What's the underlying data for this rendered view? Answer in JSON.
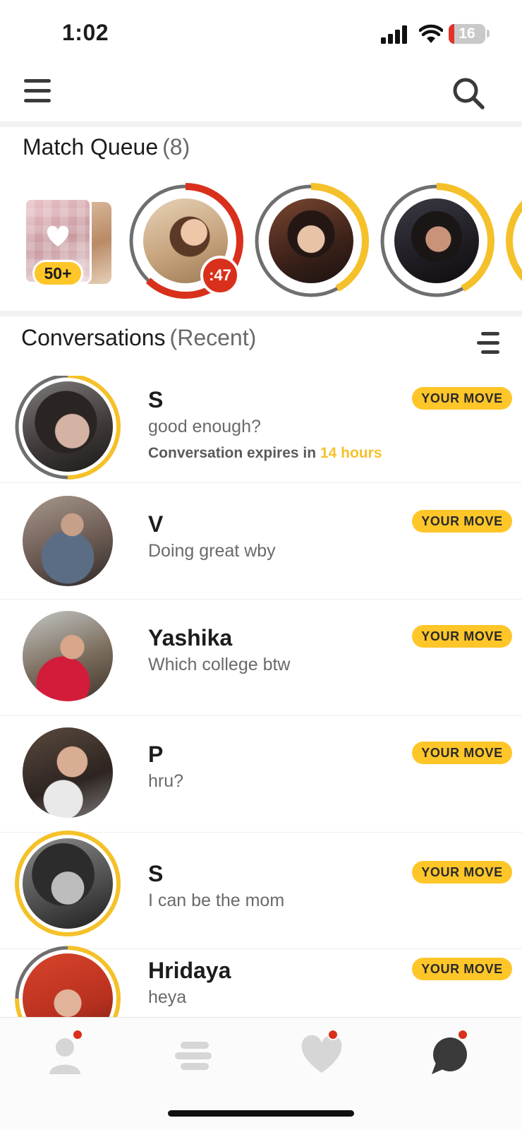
{
  "status_bar": {
    "time": "1:02",
    "battery": "16",
    "battery_fraction": 0.16
  },
  "top_nav": {
    "menu_icon": "hamburger-menu-icon",
    "search_icon": "search-icon"
  },
  "match_queue": {
    "title": "Match Queue",
    "count": "(8)",
    "stack_badge": "50+",
    "items": [
      {
        "badge": ":47",
        "ring_color": "#d9301b",
        "ring_fraction": 0.62
      },
      {
        "ring_color": "#f5c12a",
        "ring_fraction": 0.42
      },
      {
        "ring_color": "#f5c12a",
        "ring_fraction": 0.42
      }
    ]
  },
  "conversations": {
    "title": "Conversations",
    "subtitle": "(Recent)",
    "badge_label": "YOUR MOVE",
    "expiry_prefix": "Conversation expires in",
    "expiry_value": "14 hours",
    "items": [
      {
        "name": "S",
        "message": "good enough?",
        "ring_fraction": 0.5
      },
      {
        "name": "V",
        "message": "Doing great wby"
      },
      {
        "name": "Yashika",
        "message": "Which college btw"
      },
      {
        "name": "P",
        "message": "hru?"
      },
      {
        "name": "S",
        "message": "I can be the mom",
        "ring_fraction": 1.0
      },
      {
        "name": "Hridaya",
        "message": "heya",
        "ring_fraction": 0.75
      }
    ]
  },
  "colors": {
    "accent_yellow": "#ffc629",
    "expiry_yellow": "#f5c12a",
    "alert_red": "#d9301b",
    "ring_gray": "#6f6f6f"
  },
  "tab_bar": {
    "tabs": [
      {
        "icon": "profile-icon",
        "has_dot": true
      },
      {
        "icon": "discover-icon",
        "has_dot": false
      },
      {
        "icon": "likes-heart-icon",
        "has_dot": true
      },
      {
        "icon": "chat-icon",
        "has_dot": true,
        "active": true
      }
    ]
  }
}
